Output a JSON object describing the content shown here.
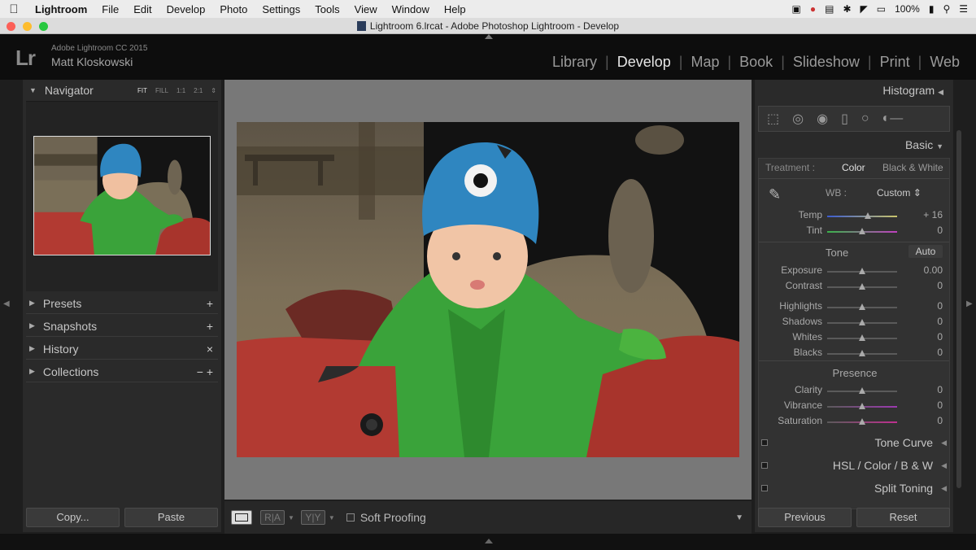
{
  "menubar": {
    "apple_icon": "apple-icon",
    "items": [
      "Lightroom",
      "File",
      "Edit",
      "Develop",
      "Photo",
      "Settings",
      "Tools",
      "View",
      "Window",
      "Help"
    ],
    "battery": "100%"
  },
  "window": {
    "title": "Lightroom 6.lrcat - Adobe Photoshop Lightroom - Develop"
  },
  "identity": {
    "logo": "Lr",
    "app_name": "Adobe Lightroom CC 2015",
    "user": "Matt Kloskowski"
  },
  "modules": [
    {
      "label": "Library",
      "active": false
    },
    {
      "label": "Develop",
      "active": true
    },
    {
      "label": "Map",
      "active": false
    },
    {
      "label": "Book",
      "active": false
    },
    {
      "label": "Slideshow",
      "active": false
    },
    {
      "label": "Print",
      "active": false
    },
    {
      "label": "Web",
      "active": false
    }
  ],
  "left_panel": {
    "navigator": {
      "title": "Navigator",
      "zoom_options": [
        "FIT",
        "FILL",
        "1:1",
        "2:1"
      ],
      "active_zoom": "FIT"
    },
    "sections": [
      {
        "label": "Presets",
        "action": "+"
      },
      {
        "label": "Snapshots",
        "action": "+"
      },
      {
        "label": "History",
        "action": "×"
      },
      {
        "label": "Collections",
        "action": "− +"
      }
    ],
    "copy_label": "Copy...",
    "paste_label": "Paste"
  },
  "toolbar": {
    "soft_proofing": "Soft Proofing",
    "ra_label": "R|A",
    "yy_label": "Y|Y"
  },
  "right_panel": {
    "histogram_title": "Histogram",
    "basic_title": "Basic",
    "treatment_label": "Treatment :",
    "treatment_color": "Color",
    "treatment_bw": "Black & White",
    "wb_label": "WB :",
    "wb_value": "Custom",
    "wb_sliders": [
      {
        "label": "Temp",
        "value": "+ 16",
        "pos": 0.58
      },
      {
        "label": "Tint",
        "value": "0",
        "pos": 0.5
      }
    ],
    "tone_label": "Tone",
    "auto_label": "Auto",
    "tone_sliders": [
      {
        "label": "Exposure",
        "value": "0.00",
        "pos": 0.5
      },
      {
        "label": "Contrast",
        "value": "0",
        "pos": 0.5
      },
      {
        "label": "Highlights",
        "value": "0",
        "pos": 0.5
      },
      {
        "label": "Shadows",
        "value": "0",
        "pos": 0.5
      },
      {
        "label": "Whites",
        "value": "0",
        "pos": 0.5
      },
      {
        "label": "Blacks",
        "value": "0",
        "pos": 0.5
      }
    ],
    "presence_label": "Presence",
    "presence_sliders": [
      {
        "label": "Clarity",
        "value": "0",
        "pos": 0.5
      },
      {
        "label": "Vibrance",
        "value": "0",
        "pos": 0.5
      },
      {
        "label": "Saturation",
        "value": "0",
        "pos": 0.5
      }
    ],
    "collapsed_sections": [
      {
        "label": "Tone Curve"
      },
      {
        "label": "HSL / Color / B & W"
      },
      {
        "label": "Split Toning"
      }
    ],
    "previous_label": "Previous",
    "reset_label": "Reset"
  },
  "colors": {
    "accent": "#e6e6e6",
    "panel": "#2a2a2a",
    "canvas": "#787878",
    "hat_blue": "#2f86c0",
    "jacket_green": "#3aa33a",
    "seat_red": "#b23a32"
  }
}
